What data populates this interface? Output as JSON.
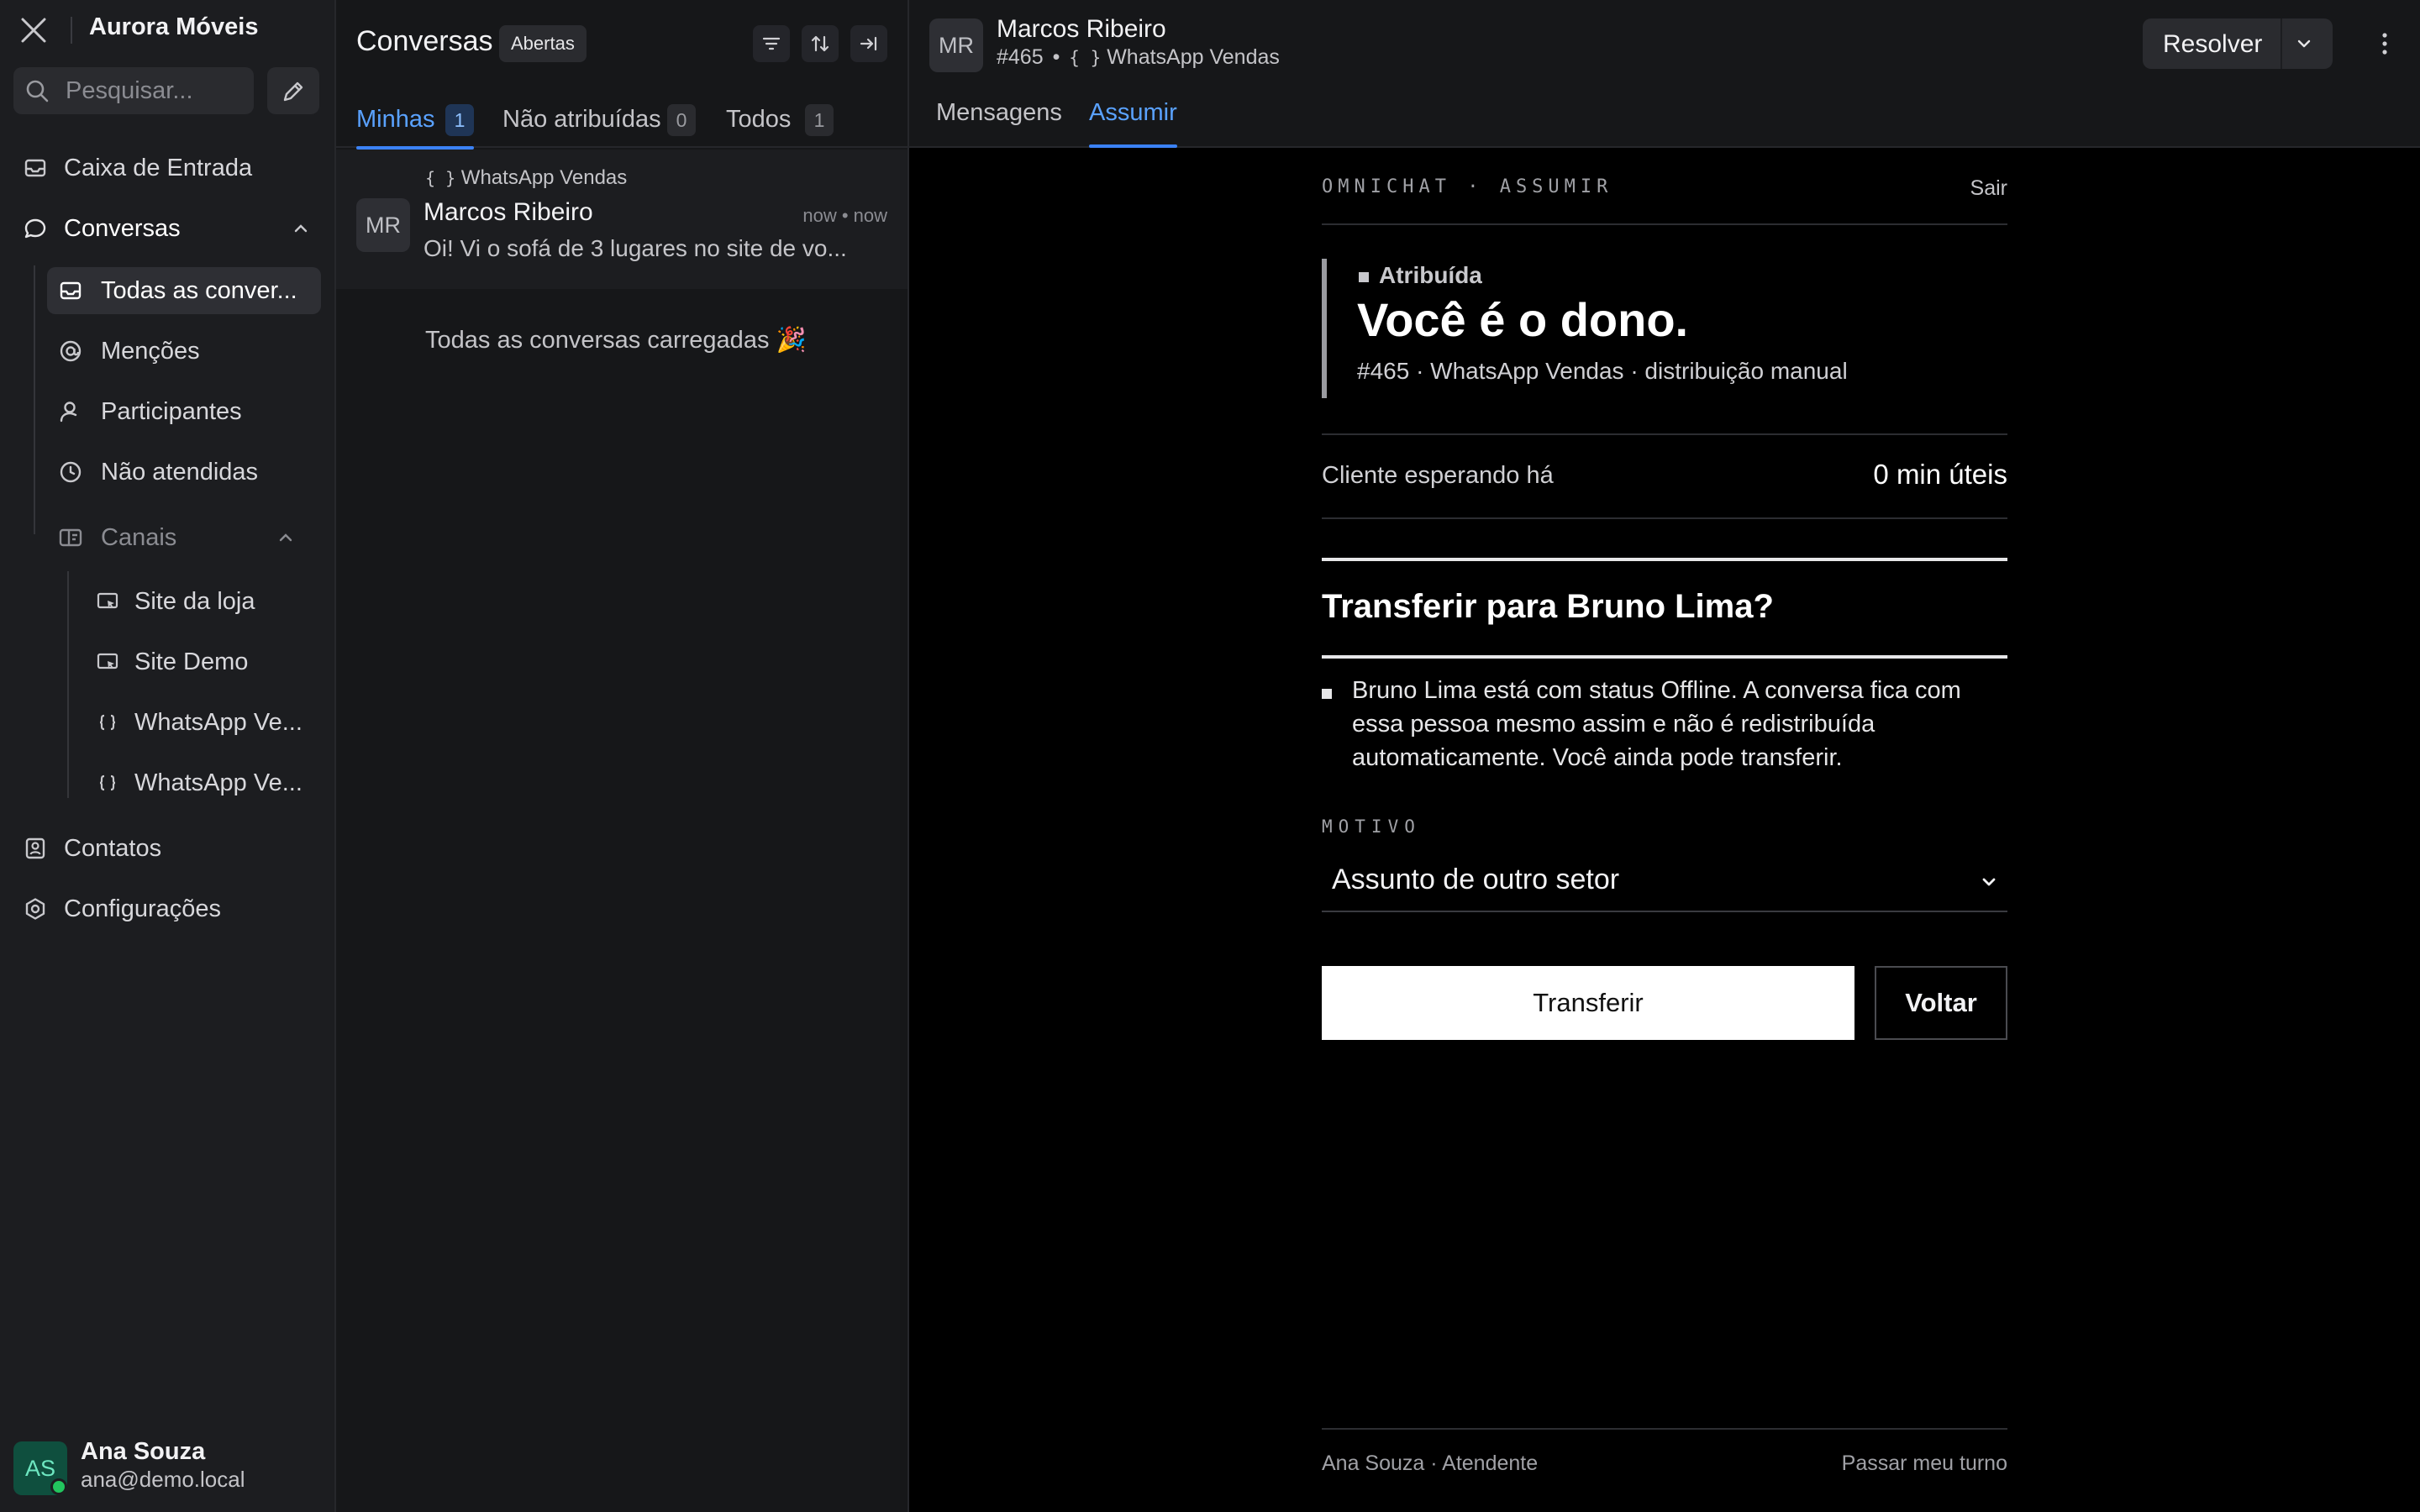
{
  "sidebar": {
    "brand": "Aurora Móveis",
    "search_placeholder": "Pesquisar...",
    "items": {
      "inbox": "Caixa de Entrada",
      "conversations": "Conversas",
      "all_conversations": "Todas as conver...",
      "mentions": "Menções",
      "participants": "Participantes",
      "unattended": "Não atendidas",
      "channels": "Canais",
      "channel_site_loja": "Site da loja",
      "channel_site_demo": "Site Demo",
      "channel_whatsapp_1": "WhatsApp Ve...",
      "channel_whatsapp_2": "WhatsApp Ve...",
      "contacts": "Contatos",
      "settings": "Configurações"
    },
    "user": {
      "initials": "AS",
      "name": "Ana Souza",
      "email": "ana@demo.local"
    }
  },
  "conv_list": {
    "title": "Conversas",
    "status_badge": "Abertas",
    "tabs": [
      {
        "label": "Minhas",
        "count": "1"
      },
      {
        "label": "Não atribuídas",
        "count": "0"
      },
      {
        "label": "Todos",
        "count": "1"
      }
    ],
    "card": {
      "channel": "WhatsApp Vendas",
      "initials": "MR",
      "name": "Marcos Ribeiro",
      "time": "now • now",
      "preview": "Oi! Vi o sofá de 3 lugares no site de vo..."
    },
    "loaded_text": "Todas as conversas carregadas 🎉"
  },
  "main": {
    "header": {
      "initials": "MR",
      "name": "Marcos Ribeiro",
      "id": "#465",
      "bullet": "•",
      "channel": "WhatsApp Vendas",
      "resolve_label": "Resolver"
    },
    "tabs": [
      "Mensagens",
      "Assumir"
    ],
    "panel": {
      "kicker": "OMNICHAT · ASSUMIR",
      "exit": "Sair",
      "owner_tag": "Atribuída",
      "owner_title": "Você é o dono.",
      "owner_meta": "#465 · WhatsApp Vendas · distribuição manual",
      "waiting_label": "Cliente esperando há",
      "waiting_value": "0 min úteis",
      "question": "Transferir para Bruno Lima?",
      "note": "Bruno Lima está com status Offline. A conversa fica com essa pessoa mesmo assim e não é redistribuída automaticamente. Você ainda pode transferir.",
      "reason_label": "MOTIVO",
      "reason_value": "Assunto de outro setor",
      "transfer_button": "Transferir",
      "back_button": "Voltar",
      "footer_left": "Ana Souza · Atendente",
      "footer_right": "Passar meu turno"
    }
  },
  "colors": {
    "accent": "#3b82f6",
    "online": "#22c55e",
    "background": "#000000",
    "panel": "#1c1d20"
  }
}
